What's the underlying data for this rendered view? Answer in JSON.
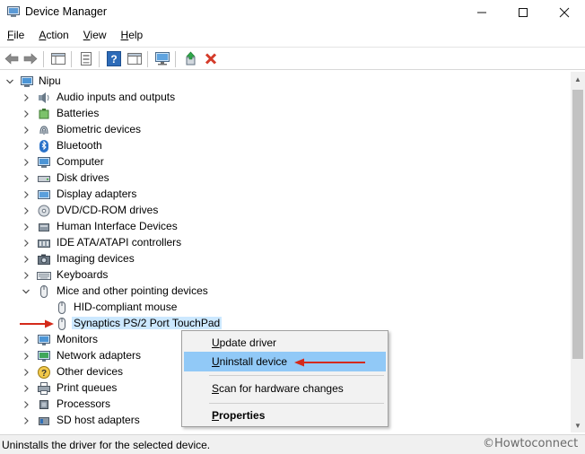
{
  "window": {
    "title": "Device Manager",
    "minimize_glyph": "—",
    "maximize_glyph": "☐",
    "close_glyph": "✕"
  },
  "menu": [
    {
      "accel": "F",
      "rest": "ile"
    },
    {
      "accel": "A",
      "rest": "ction"
    },
    {
      "accel": "V",
      "rest": "iew"
    },
    {
      "accel": "H",
      "rest": "elp"
    }
  ],
  "toolbar": {
    "icons": [
      "back-arrow-icon",
      "forward-arrow-icon",
      "show-hide-tree-icon",
      "properties-sheet-icon",
      "help-icon",
      "action-pane-icon",
      "monitor-scan-icon",
      "update-driver-icon",
      "uninstall-x-icon"
    ]
  },
  "tree": {
    "root": "Nipu",
    "categories": [
      {
        "label": "Audio inputs and outputs",
        "icon": "speaker-icon"
      },
      {
        "label": "Batteries",
        "icon": "battery-icon"
      },
      {
        "label": "Biometric devices",
        "icon": "fingerprint-icon"
      },
      {
        "label": "Bluetooth",
        "icon": "bluetooth-icon"
      },
      {
        "label": "Computer",
        "icon": "computer-icon"
      },
      {
        "label": "Disk drives",
        "icon": "disk-drive-icon"
      },
      {
        "label": "Display adapters",
        "icon": "display-adapter-icon"
      },
      {
        "label": "DVD/CD-ROM drives",
        "icon": "dvd-drive-icon"
      },
      {
        "label": "Human Interface Devices",
        "icon": "hid-icon"
      },
      {
        "label": "IDE ATA/ATAPI controllers",
        "icon": "ide-controller-icon"
      },
      {
        "label": "Imaging devices",
        "icon": "camera-icon"
      },
      {
        "label": "Keyboards",
        "icon": "keyboard-icon"
      },
      {
        "label": "Mice and other pointing devices",
        "icon": "mouse-icon"
      }
    ],
    "mice_children": [
      {
        "label": "HID-compliant mouse",
        "icon": "mouse-icon"
      },
      {
        "label": "Synaptics PS/2 Port TouchPad",
        "icon": "mouse-icon"
      }
    ],
    "categories_after": [
      {
        "label": "Monitors",
        "icon": "monitor-icon"
      },
      {
        "label": "Network adapters",
        "icon": "network-adapter-icon"
      },
      {
        "label": "Other devices",
        "icon": "unknown-device-icon"
      },
      {
        "label": "Print queues",
        "icon": "printer-icon"
      },
      {
        "label": "Processors",
        "icon": "processor-icon"
      },
      {
        "label": "SD host adapters",
        "icon": "sd-adapter-icon"
      }
    ]
  },
  "context_menu": {
    "update_driver": "Update driver",
    "uninstall_device": "Uninstall device",
    "scan": "Scan for hardware changes",
    "properties": "Properties"
  },
  "status": {
    "text": "Uninstalls the driver for the selected device.",
    "watermark": "©Howtoconnect"
  },
  "colors": {
    "selection": "#cce8ff",
    "menu_hover": "#91c9f7",
    "annotation_arrow": "#d42a1a"
  }
}
